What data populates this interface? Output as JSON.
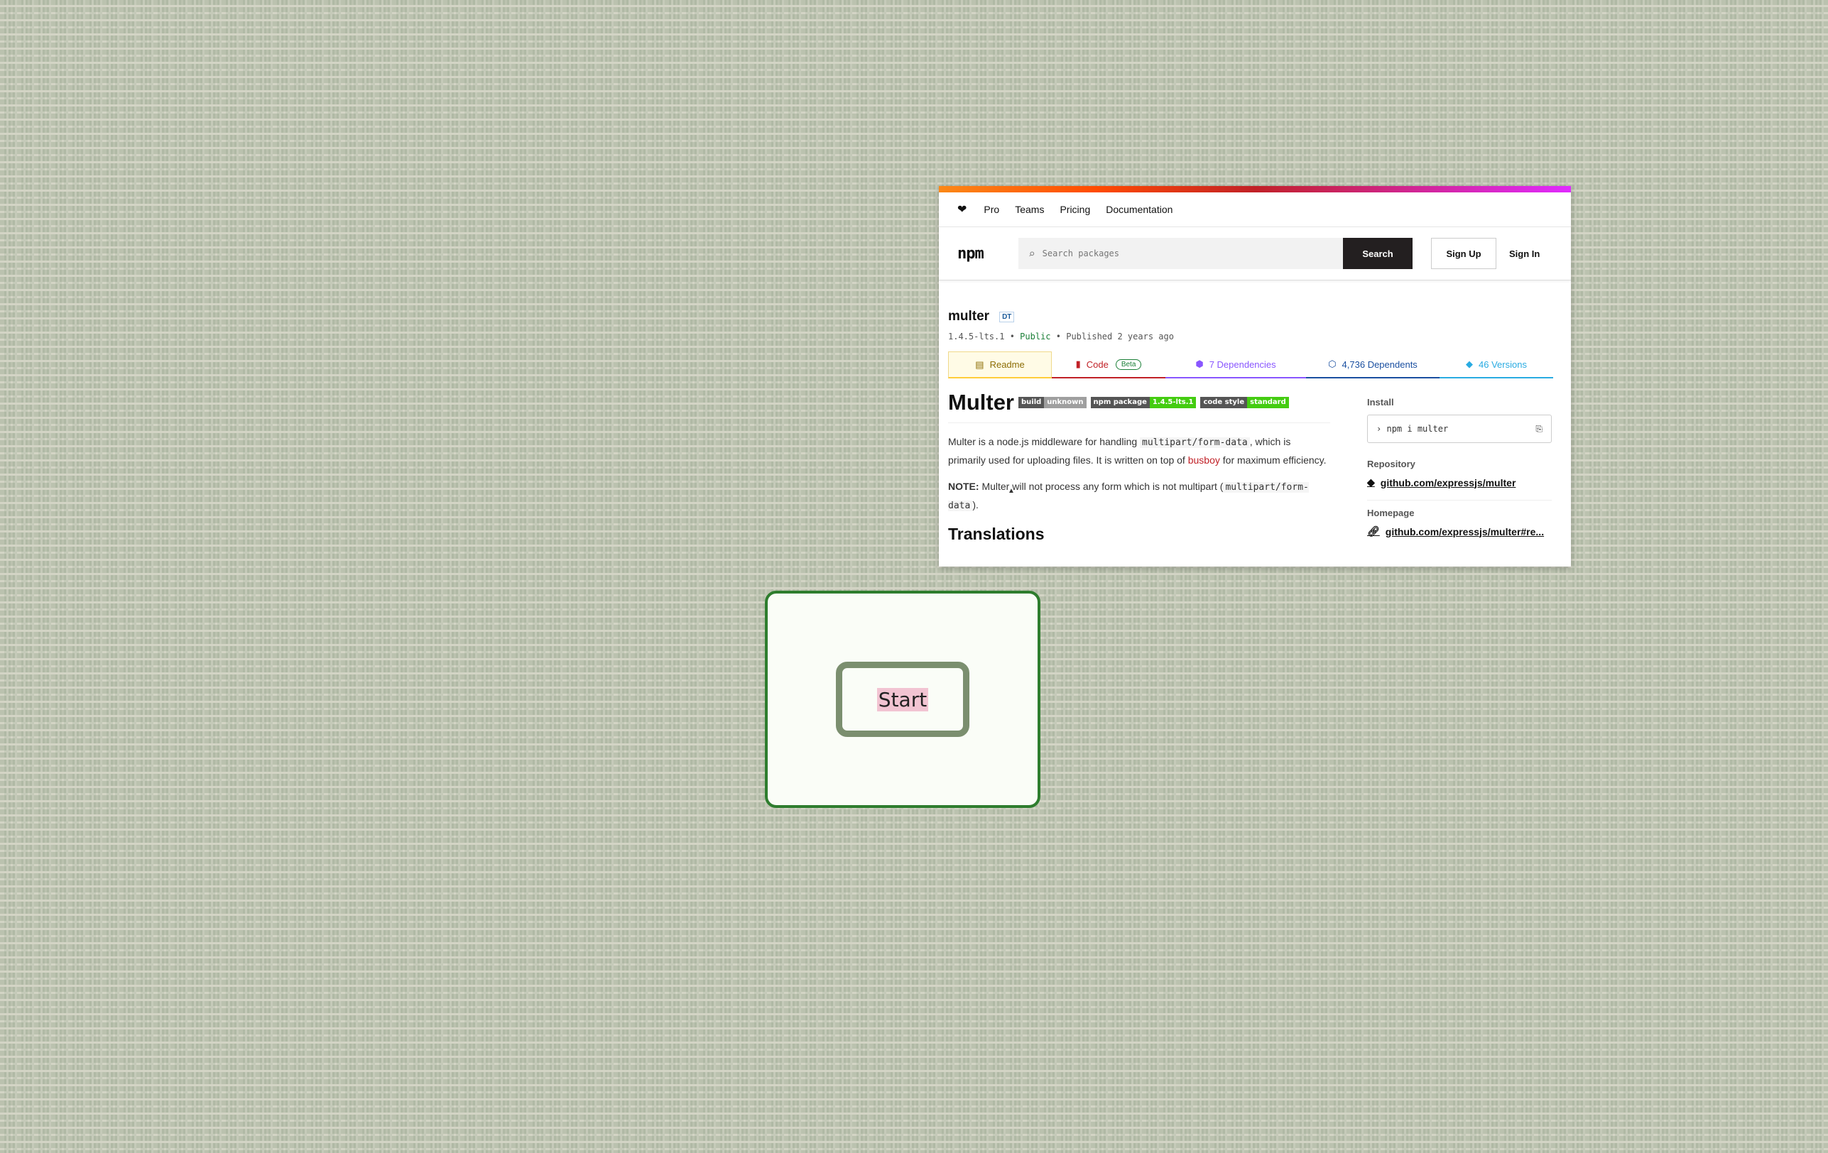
{
  "npm": {
    "topnav": [
      "Pro",
      "Teams",
      "Pricing",
      "Documentation"
    ],
    "heart_icon": "heart-icon",
    "logo": "npm",
    "search_placeholder": "Search packages",
    "search_button": "Search",
    "signup": "Sign Up",
    "signin": "Sign In",
    "package": {
      "name": "multer",
      "badge": "DT",
      "version": "1.4.5-lts.1",
      "visibility": "Public",
      "published": "Published 2 years ago"
    },
    "tabs": {
      "readme": "Readme",
      "code": "Code",
      "beta": "Beta",
      "dependencies": "7 Dependencies",
      "dependents": "4,736 Dependents",
      "versions": "46 Versions"
    },
    "readme": {
      "title": "Multer",
      "shields": [
        {
          "left": "build",
          "right": "unknown",
          "color": "#9f9f9f"
        },
        {
          "left": "npm package",
          "right": "1.4.5-lts.1",
          "color": "#4c1"
        },
        {
          "left": "code style",
          "right": "standard",
          "color": "#4c1"
        }
      ],
      "p1_a": "Multer is a node.js middleware for handling ",
      "p1_code": "multipart/form-data",
      "p1_b": ", which is primarily used for uploading files. It is written on top of ",
      "p1_link": "busboy",
      "p1_c": " for maximum efficiency.",
      "note_label": "NOTE:",
      "note_a": " Multer will not process any form which is not multipart (",
      "note_code": "multipart/form-data",
      "note_b": ").",
      "h2": "Translations"
    },
    "sidebar": {
      "install_label": "Install",
      "install_cmd": "npm i multer",
      "repo_label": "Repository",
      "repo_link": "github.com/expressjs/multer",
      "home_label": "Homepage",
      "home_link": "github.com/expressjs/multer#re..."
    }
  },
  "start_dialog": {
    "button": "Start"
  }
}
